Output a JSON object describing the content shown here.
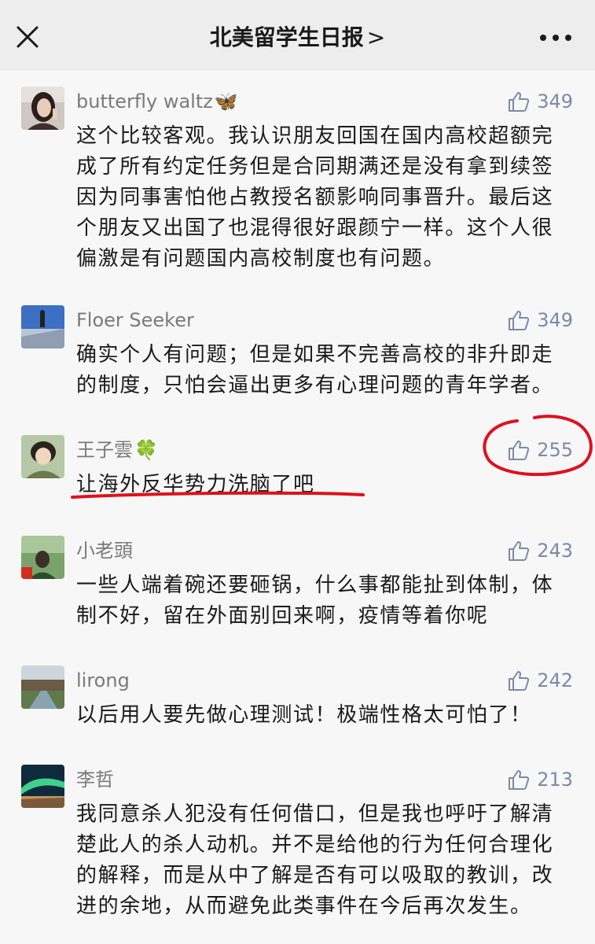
{
  "header": {
    "title": "北美留学生日报",
    "chevron": ">"
  },
  "icons": {
    "close": "close-icon",
    "more": "more-icon",
    "like": "thumbs-up-icon"
  },
  "colors": {
    "background": "#ededed",
    "list_background": "#f7f7f7",
    "username": "#7a7a7a",
    "like_count": "#7a8aa8",
    "annotation": "#e0101e"
  },
  "comments": [
    {
      "username": "butterfly waltz",
      "name_decoration": "🦋",
      "likes": "349",
      "text": "这个比较客观。我认识朋友回国在国内高校超额完成了所有约定任务但是合同期满还是没有拿到续签因为同事害怕他占教授名额影响同事晋升。最后这个朋友又出国了也混得很好跟颜宁一样。这个人很偏激是有问题国内高校制度也有问题。"
    },
    {
      "username": "Floer Seeker",
      "name_decoration": "",
      "likes": "349",
      "text": "确实个人有问题；但是如果不完善高校的非升即走的制度，只怕会逼出更多有心理问题的青年学者。"
    },
    {
      "username": "王子雲",
      "name_decoration": "🍀",
      "likes": "255",
      "text": "让海外反华势力洗脑了吧"
    },
    {
      "username": "小老頭",
      "name_decoration": "",
      "likes": "243",
      "text": "一些人端着碗还要砸锅，什么事都能扯到体制，体制不好，留在外面别回来啊，疫情等着你呢"
    },
    {
      "username": "lirong",
      "name_decoration": "",
      "likes": "242",
      "text": "以后用人要先做心理测试！极端性格太可怕了！"
    },
    {
      "username": "李哲",
      "name_decoration": "",
      "likes": "213",
      "text": "我同意杀人犯没有任何借口，但是我也呼吁了解清楚此人的杀人动机。并不是给他的行为任何合理化的解释，而是从中了解是否有可以吸取的教训，改进的余地，从而避免此类事件在今后再次发生。"
    }
  ]
}
